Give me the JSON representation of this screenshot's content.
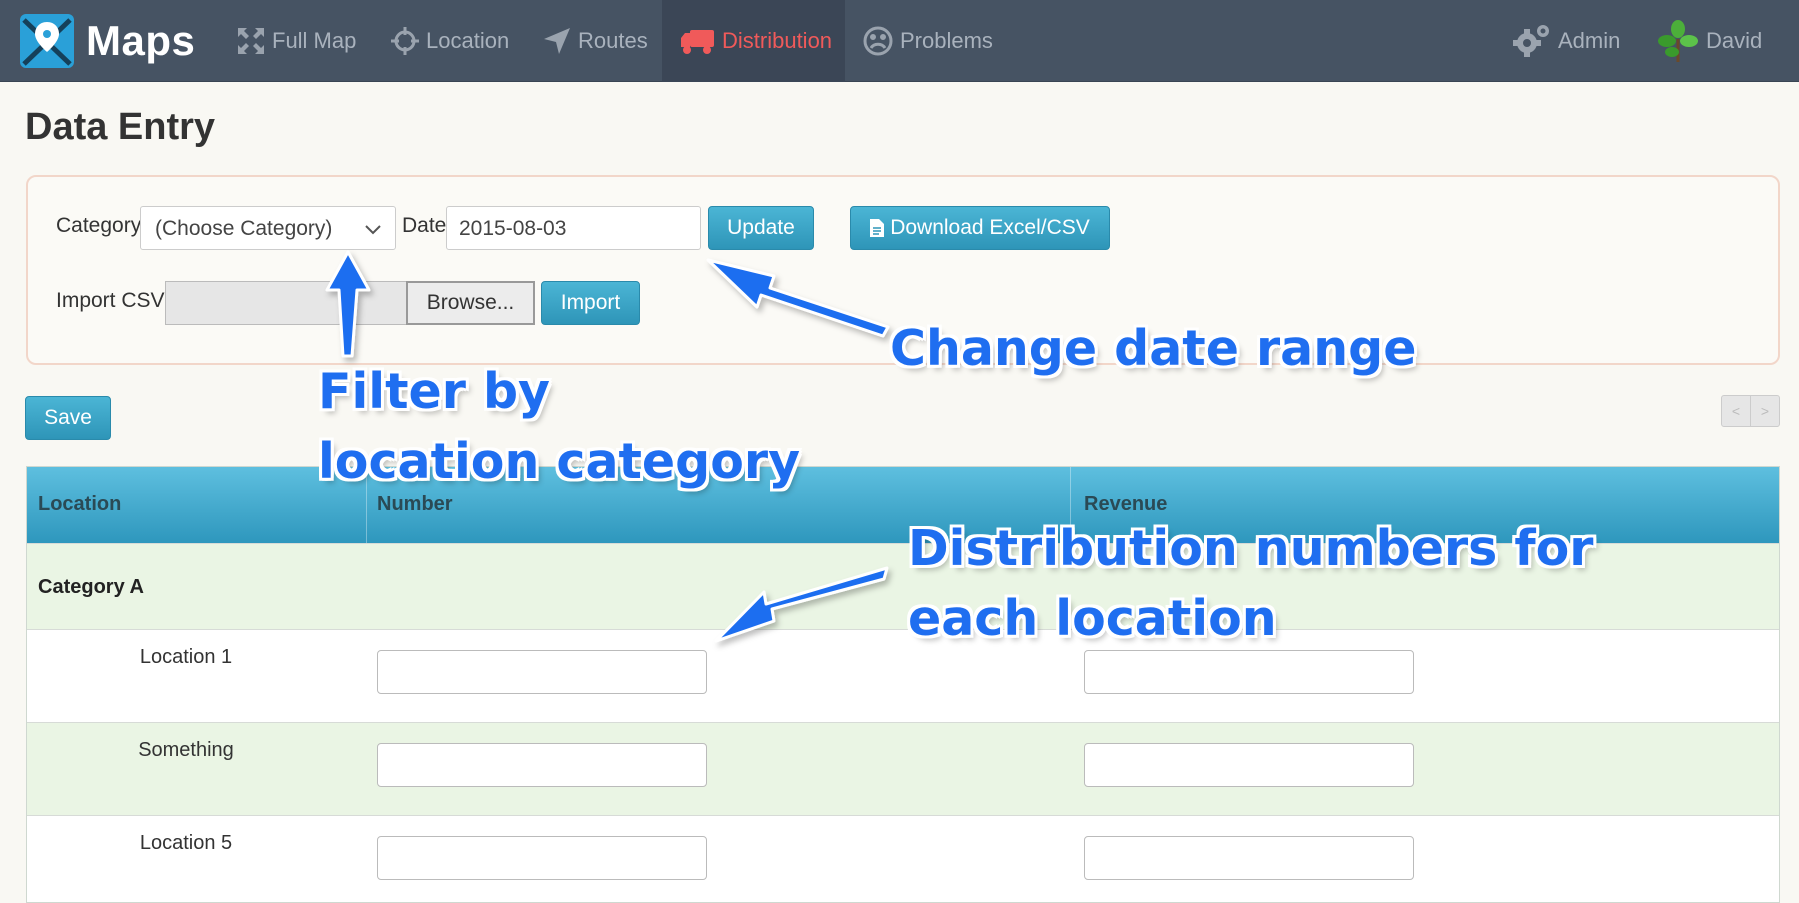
{
  "brand": {
    "name": "Maps",
    "logo_icon": "map-pin-logo-icon"
  },
  "nav": [
    {
      "label": "Full Map",
      "icon": "expand-arrows-icon"
    },
    {
      "label": "Location",
      "icon": "crosshair-icon"
    },
    {
      "label": "Routes",
      "icon": "navigation-arrow-icon"
    },
    {
      "label": "Distribution",
      "icon": "truck-icon",
      "active": true
    },
    {
      "label": "Problems",
      "icon": "frown-face-icon"
    }
  ],
  "nav_right": {
    "admin": {
      "label": "Admin",
      "icon": "gears-icon"
    },
    "user": {
      "label": "David",
      "icon": "plant-avatar-icon"
    }
  },
  "page": {
    "title": "Data Entry"
  },
  "filters": {
    "category_label": "Category",
    "category_value": "(Choose Category)",
    "date_label": "Date",
    "date_value": "2015-08-03",
    "update_label": "Update",
    "download_label": "Download Excel/CSV",
    "import_label": "Import CSV",
    "browse_label": "Browse...",
    "import_button": "Import"
  },
  "actions": {
    "save_label": "Save",
    "pager_prev": "<",
    "pager_next": ">"
  },
  "table": {
    "columns": [
      "Location",
      "Number",
      "Revenue"
    ],
    "category": "Category A",
    "rows": [
      {
        "location": "Location 1",
        "number": "",
        "revenue": ""
      },
      {
        "location": "Something",
        "number": "",
        "revenue": ""
      },
      {
        "location": "Location 5",
        "number": "",
        "revenue": ""
      }
    ]
  },
  "annotations": {
    "filter_line1": "Filter by",
    "filter_line2": "location category",
    "date_range": "Change date range",
    "dist_line1": "Distribution numbers for",
    "dist_line2": "each location"
  },
  "colors": {
    "navbar": "#465363",
    "active_nav": "#f05a5a",
    "button_blue": "#2e95b8",
    "callout_blue": "#1f6ef0",
    "row_green": "#eaf5e4"
  }
}
